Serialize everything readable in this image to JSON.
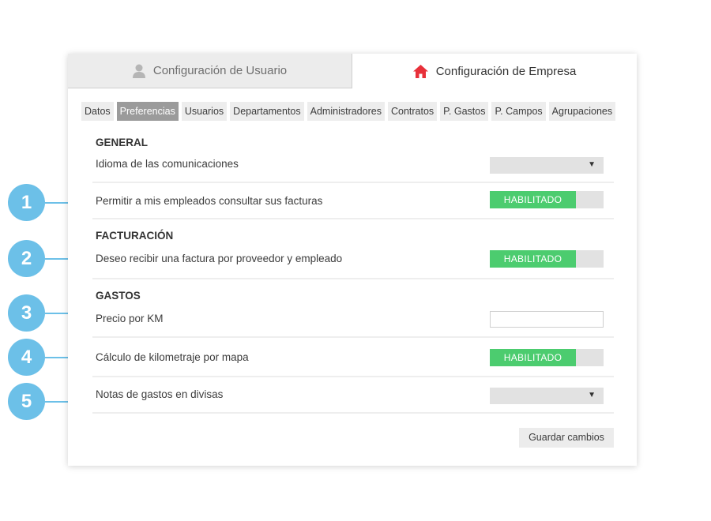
{
  "tabs": {
    "user": "Configuración de Usuario",
    "company": "Configuración de Empresa"
  },
  "subtabs": [
    "Datos",
    "Preferencias",
    "Usuarios",
    "Departamentos",
    "Administradores",
    "Contratos",
    "P. Gastos",
    "P. Campos",
    "Agrupaciones"
  ],
  "active_subtab": "Preferencias",
  "sections": {
    "general": "GENERAL",
    "facturacion": "FACTURACIÓN",
    "gastos": "GASTOS"
  },
  "rows": {
    "idioma": "Idioma de las comunicaciones",
    "consultar_facturas": "Permitir a mis empleados consultar sus facturas",
    "factura_proveedor": "Deseo recibir una factura por proveedor y empleado",
    "precio_km": "Precio por KM",
    "kilometraje": "Cálculo de kilometraje por mapa",
    "divisas": "Notas de gastos en divisas"
  },
  "toggle_label": "HABILITADO",
  "save_label": "Guardar cambios",
  "callouts": [
    "1",
    "2",
    "3",
    "4",
    "5"
  ],
  "colors": {
    "accent_red": "#e8303a",
    "toggle_on": "#4ccc6f",
    "callout": "#6cc0e8",
    "active_subtab": "#9b9b9b"
  },
  "icons": {
    "user_tab": "user-icon",
    "company_tab": "home-icon",
    "select": "caret-down-icon"
  }
}
